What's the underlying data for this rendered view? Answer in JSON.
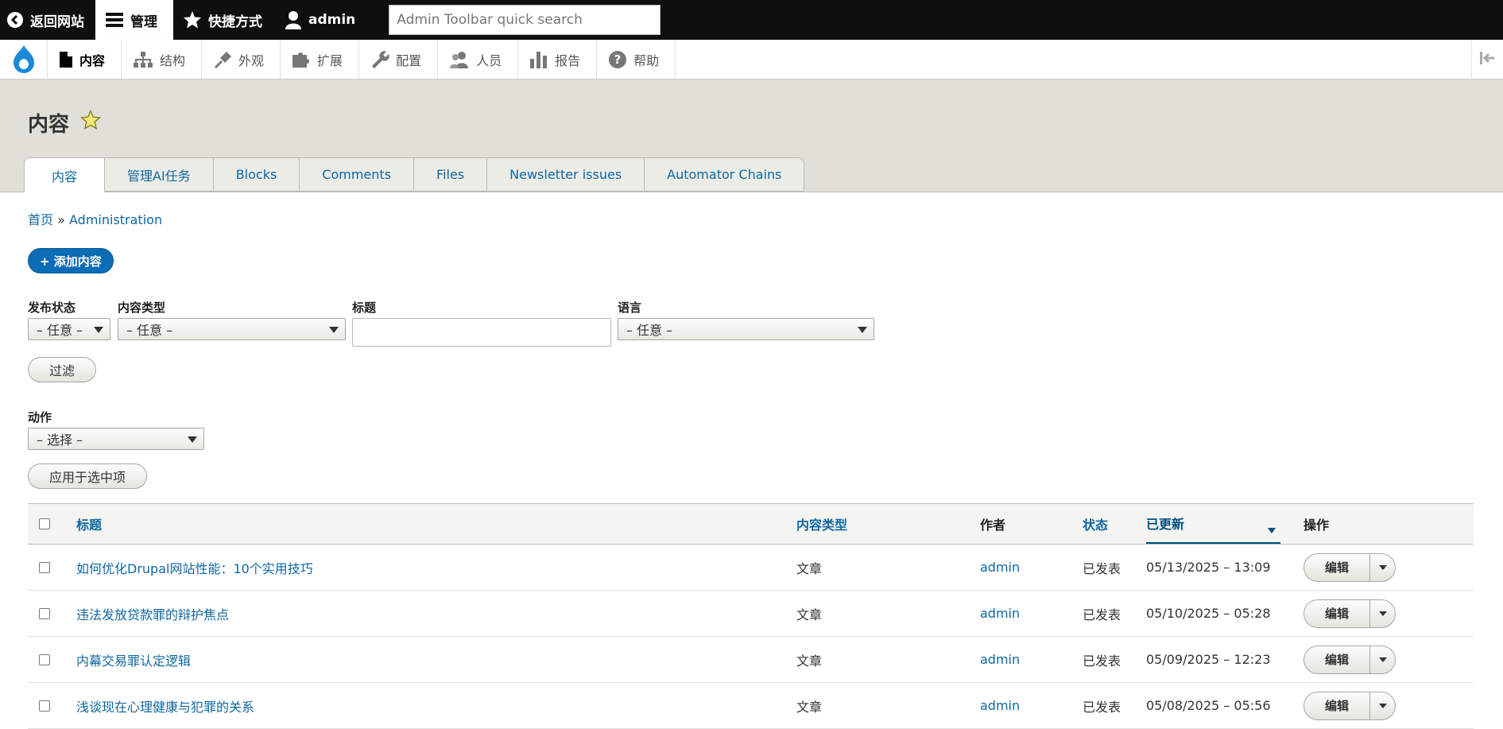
{
  "toolbar": {
    "back_label": "返回网站",
    "manage_label": "管理",
    "shortcuts_label": "快捷方式",
    "user_label": "admin",
    "search_placeholder": "Admin Toolbar quick search"
  },
  "tray": {
    "items": [
      {
        "label": "内容",
        "icon": "file-icon"
      },
      {
        "label": "结构",
        "icon": "sitemap-icon"
      },
      {
        "label": "外观",
        "icon": "brush-icon"
      },
      {
        "label": "扩展",
        "icon": "puzzle-icon"
      },
      {
        "label": "配置",
        "icon": "wrench-icon"
      },
      {
        "label": "人员",
        "icon": "people-icon"
      },
      {
        "label": "报告",
        "icon": "chart-icon"
      },
      {
        "label": "帮助",
        "icon": "help-icon"
      }
    ]
  },
  "page": {
    "title": "内容",
    "tabs": [
      "内容",
      "管理AI任务",
      "Blocks",
      "Comments",
      "Files",
      "Newsletter issues",
      "Automator Chains"
    ],
    "breadcrumb": {
      "home": "首页",
      "separator": "»",
      "current": "Administration"
    },
    "add_button": "+ 添加内容"
  },
  "filters": {
    "status_label": "发布状态",
    "status_value": "– 任意 –",
    "type_label": "内容类型",
    "type_value": "– 任意 –",
    "title_label": "标题",
    "title_value": "",
    "lang_label": "语言",
    "lang_value": "– 任意 –",
    "filter_button": "过滤"
  },
  "bulk": {
    "action_label": "动作",
    "action_value": "– 选择 –",
    "apply_button": "应用于选中项"
  },
  "table": {
    "headers": {
      "title": "标题",
      "type": "内容类型",
      "author": "作者",
      "status": "状态",
      "updated": "已更新",
      "ops": "操作"
    },
    "rows": [
      {
        "title": "如何优化Drupal网站性能：10个实用技巧",
        "type": "文章",
        "author": "admin",
        "status": "已发表",
        "updated": "05/13/2025 – 13:09",
        "op": "编辑"
      },
      {
        "title": "违法发放贷款罪的辩护焦点",
        "type": "文章",
        "author": "admin",
        "status": "已发表",
        "updated": "05/10/2025 – 05:28",
        "op": "编辑"
      },
      {
        "title": "内幕交易罪认定逻辑",
        "type": "文章",
        "author": "admin",
        "status": "已发表",
        "updated": "05/09/2025 – 12:23",
        "op": "编辑"
      },
      {
        "title": "浅谈现在心理健康与犯罪的关系",
        "type": "文章",
        "author": "admin",
        "status": "已发表",
        "updated": "05/08/2025 – 05:56",
        "op": "编辑"
      }
    ]
  },
  "colors": {
    "link": "#0f67a3",
    "primary_button": "#0c6cb5",
    "header_band": "#e0e0d8",
    "toolbar": "#0f0f0f"
  }
}
